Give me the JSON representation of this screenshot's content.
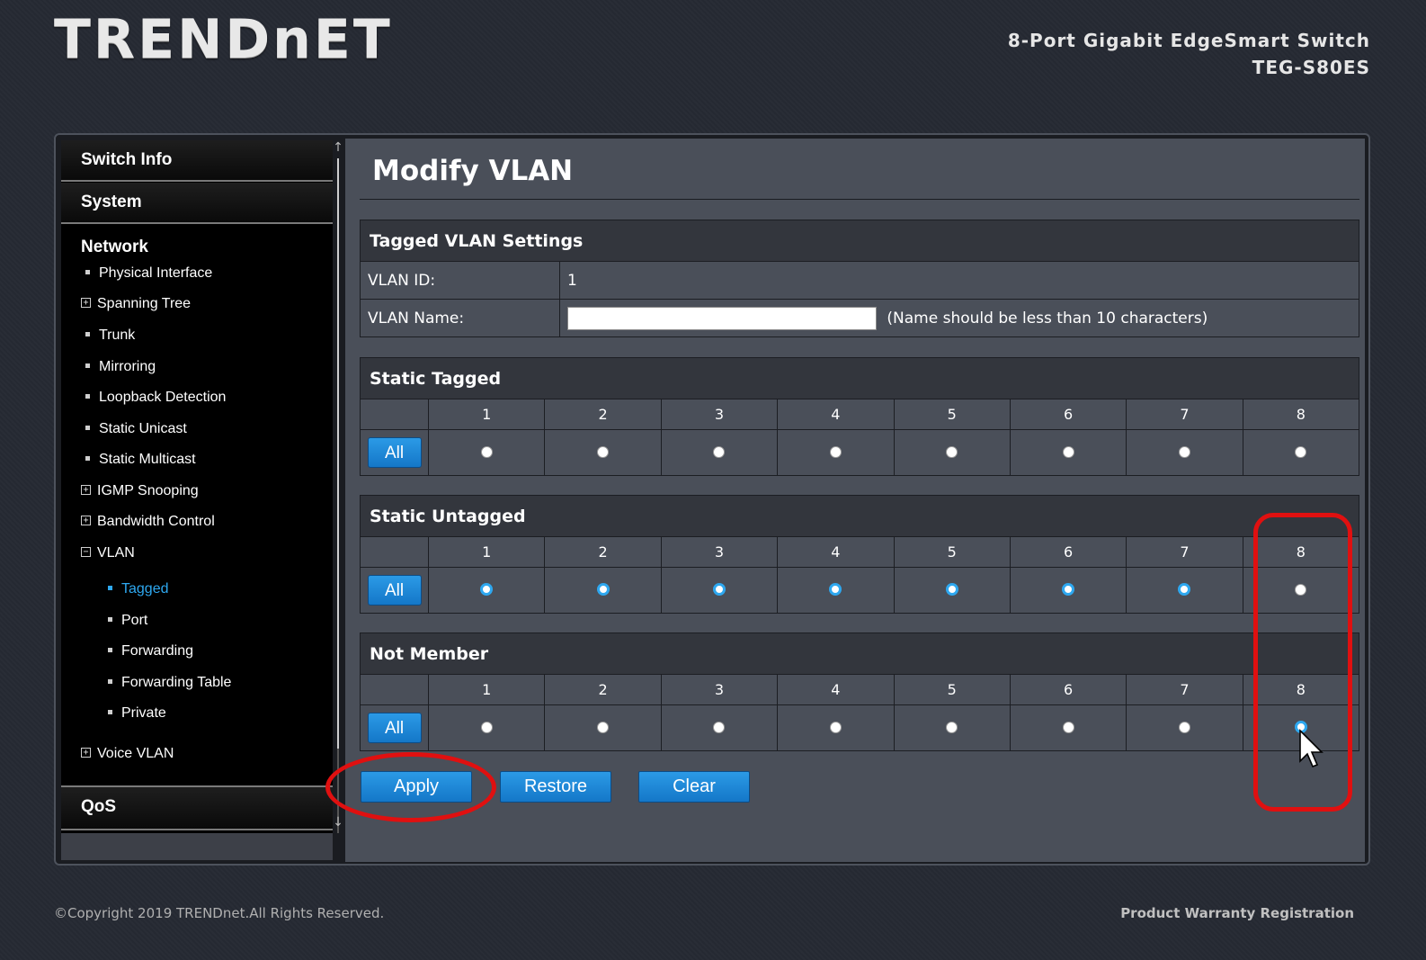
{
  "header": {
    "logo_text": "TRENDnET",
    "product_line1": "8-Port Gigabit EdgeSmart Switch",
    "product_line2": "TEG-S80ES"
  },
  "sidebar": {
    "switch_info": "Switch Info",
    "system": "System",
    "network": "Network",
    "items": [
      {
        "label": "Physical Interface",
        "marker": "bullet"
      },
      {
        "label": "Spanning Tree",
        "marker": "plus"
      },
      {
        "label": "Trunk",
        "marker": "bullet"
      },
      {
        "label": "Mirroring",
        "marker": "bullet"
      },
      {
        "label": "Loopback Detection",
        "marker": "bullet"
      },
      {
        "label": "Static Unicast",
        "marker": "bullet"
      },
      {
        "label": "Static Multicast",
        "marker": "bullet"
      },
      {
        "label": "IGMP Snooping",
        "marker": "plus"
      },
      {
        "label": "Bandwidth Control",
        "marker": "plus"
      },
      {
        "label": "VLAN",
        "marker": "minus"
      }
    ],
    "vlan_subitems": [
      {
        "label": "Tagged",
        "active": true
      },
      {
        "label": "Port",
        "active": false
      },
      {
        "label": "Forwarding",
        "active": false
      },
      {
        "label": "Forwarding Table",
        "active": false
      },
      {
        "label": "Private",
        "active": false
      }
    ],
    "voice_vlan": "Voice VLAN",
    "qos": "QoS",
    "expander_plus": "+",
    "expander_minus": "−"
  },
  "main": {
    "title": "Modify VLAN",
    "settings": {
      "header": "Tagged VLAN Settings",
      "vlan_id_label": "VLAN ID:",
      "vlan_id_value": "1",
      "vlan_name_label": "VLAN Name:",
      "vlan_name_value": "",
      "vlan_name_hint": "(Name should be less than 10 characters)"
    },
    "ports": [
      "1",
      "2",
      "3",
      "4",
      "5",
      "6",
      "7",
      "8"
    ],
    "all_label": "All",
    "groups": [
      {
        "header": "Static Tagged",
        "checked": [
          false,
          false,
          false,
          false,
          false,
          false,
          false,
          false
        ]
      },
      {
        "header": "Static Untagged",
        "checked": [
          true,
          true,
          true,
          true,
          true,
          true,
          true,
          false
        ]
      },
      {
        "header": "Not Member",
        "checked": [
          false,
          false,
          false,
          false,
          false,
          false,
          false,
          true
        ]
      }
    ],
    "buttons": {
      "apply": "Apply",
      "restore": "Restore",
      "clear": "Clear"
    }
  },
  "footer": {
    "copyright": "©Copyright 2019 TRENDnet.All Rights Reserved.",
    "warranty": "Product Warranty Registration"
  },
  "colors": {
    "accent_blue": "#2ea8f0",
    "annotation_red": "#e01010"
  }
}
